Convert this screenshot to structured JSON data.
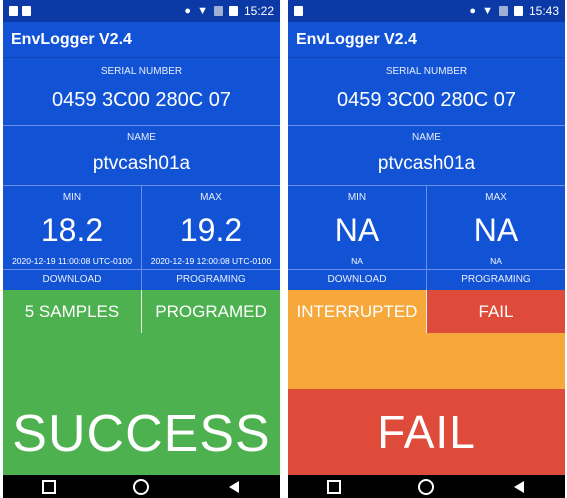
{
  "left": {
    "status_time": "15:22",
    "app_title": "EnvLogger V2.4",
    "serial_label": "SERIAL NUMBER",
    "serial_value": "0459 3C00 280C 07",
    "name_label": "NAME",
    "name_value": "ptvcash01a",
    "min_label": "MIN",
    "max_label": "MAX",
    "min_value": "18.2",
    "max_value": "19.2",
    "min_timestamp": "2020-12-19 11:00:08 UTC-0100",
    "max_timestamp": "2020-12-19 12:00:08 UTC-0100",
    "download_label": "DOWNLOAD",
    "programing_label": "PROGRAMING",
    "download_status": "5 SAMPLES",
    "programing_status": "PROGRAMED",
    "result": "SUCCESS",
    "colors": {
      "primary": "#1253d6",
      "success": "#4db150"
    }
  },
  "right": {
    "status_time": "15:43",
    "app_title": "EnvLogger V2.4",
    "serial_label": "SERIAL NUMBER",
    "serial_value": "0459 3C00 280C 07",
    "name_label": "NAME",
    "name_value": "ptvcash01a",
    "min_label": "MIN",
    "max_label": "MAX",
    "min_value": "NA",
    "max_value": "NA",
    "min_timestamp": "NA",
    "max_timestamp": "NA",
    "download_label": "DOWNLOAD",
    "programing_label": "PROGRAMING",
    "download_status": "INTERRUPTED",
    "programing_status": "FAIL",
    "result": "FAIL",
    "colors": {
      "primary": "#1253d6",
      "warning": "#f6a83a",
      "fail": "#df4b3a"
    }
  },
  "icons": {
    "status_left": [
      "image-icon",
      "sim-icon"
    ],
    "status_right": [
      "location-icon",
      "wifi-icon",
      "signal-icon",
      "battery-icon"
    ],
    "nav": [
      "recents-icon",
      "home-icon",
      "back-icon"
    ]
  }
}
